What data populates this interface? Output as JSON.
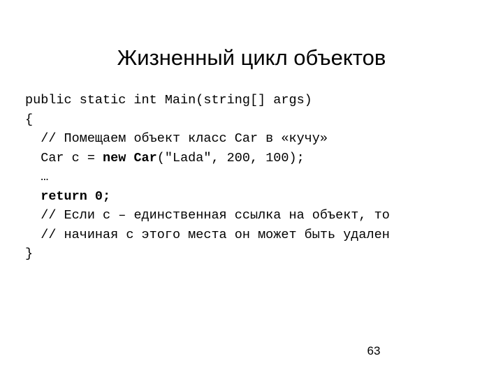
{
  "slide": {
    "title": "Жизненный цикл объектов",
    "background_color": "#ffffff",
    "text_color": "#000000",
    "page_number": "63"
  },
  "code": {
    "language": "csharp",
    "lines": [
      {
        "indent": "",
        "segments": [
          {
            "text": "public static int Main(string[] args)",
            "bold": false
          }
        ]
      },
      {
        "indent": "",
        "segments": [
          {
            "text": "{",
            "bold": false
          }
        ]
      },
      {
        "indent": "  ",
        "segments": [
          {
            "text": "// Помещаем объект класс Car в «кучу»",
            "bold": false
          }
        ]
      },
      {
        "indent": "  ",
        "segments": [
          {
            "text": "Car c = ",
            "bold": false
          },
          {
            "text": "new Car",
            "bold": true
          },
          {
            "text": "(\"Lada\", 200, 100);",
            "bold": false
          }
        ]
      },
      {
        "indent": "  ",
        "segments": [
          {
            "text": "…",
            "bold": false
          }
        ]
      },
      {
        "indent": "  ",
        "segments": [
          {
            "text": "return 0;",
            "bold": true
          }
        ]
      },
      {
        "indent": "  ",
        "segments": [
          {
            "text": "// Если c – единственная ссылка на объект, то",
            "bold": false
          }
        ]
      },
      {
        "indent": "  ",
        "segments": [
          {
            "text": "// начиная с этого места он может быть удален",
            "bold": false
          }
        ]
      },
      {
        "indent": "",
        "segments": [
          {
            "text": "}",
            "bold": false
          }
        ]
      }
    ],
    "plain_text": "public static int Main(string[] args)\n{\n  // Помещаем объект класс Car в «кучу»\n  Car c = new Car(\"Lada\", 200, 100);\n  …\n  return 0;\n  // Если c – единственная ссылка на объект, то\n  // начиная с этого места он может быть удален\n}"
  }
}
